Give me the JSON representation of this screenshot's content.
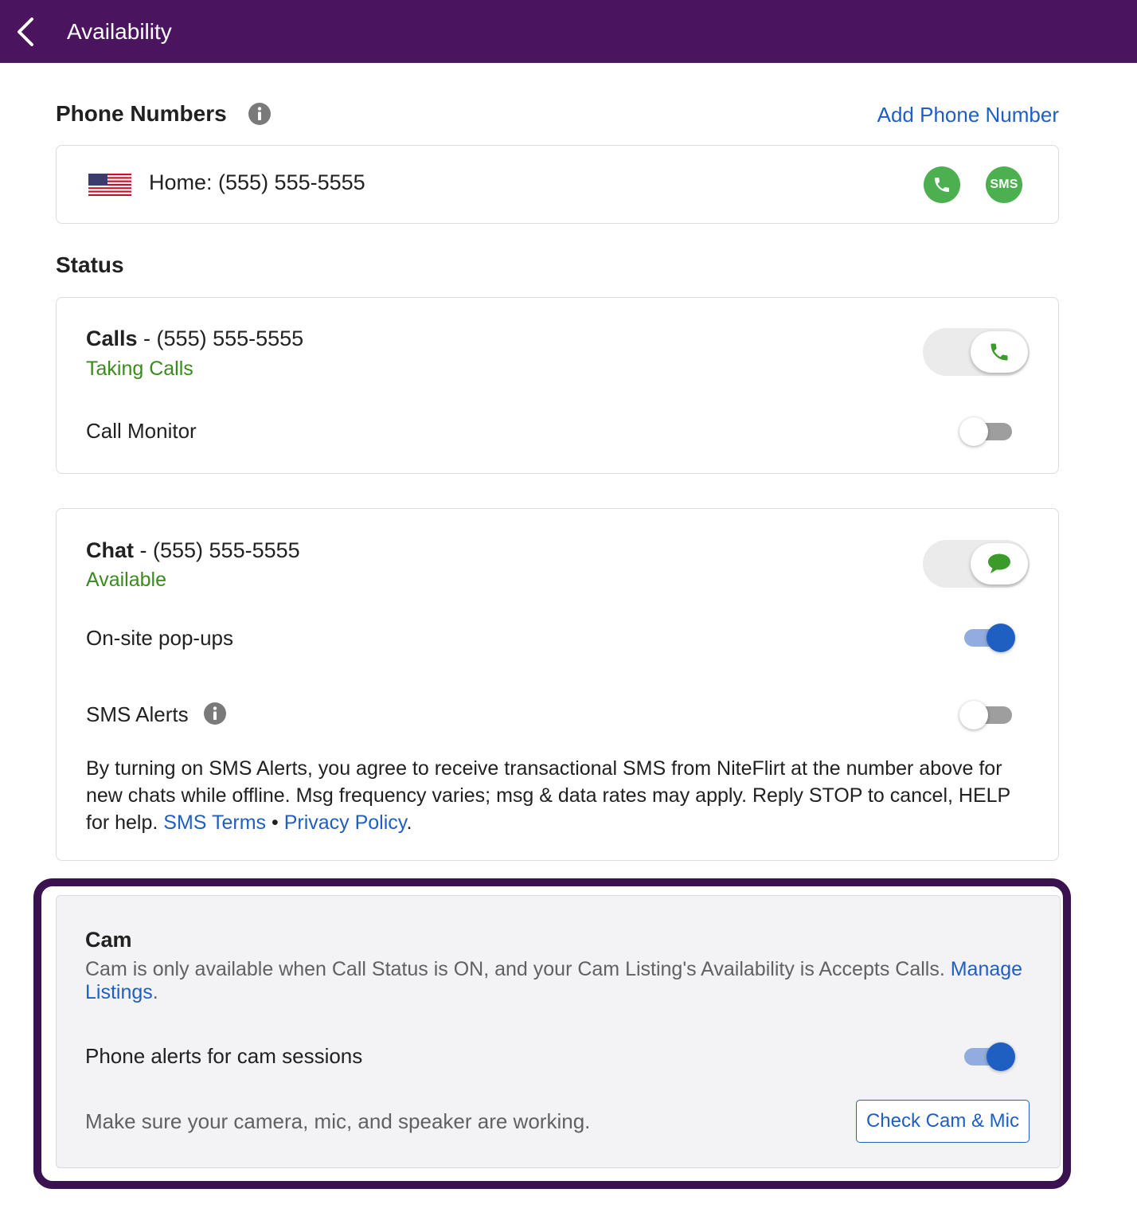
{
  "header": {
    "title": "Availability",
    "background_color": "#4a155e"
  },
  "phone_numbers": {
    "title": "Phone Numbers",
    "add_link": "Add Phone Number",
    "entries": [
      {
        "label": "Home: (555) 555-5555",
        "flag_icon": "us-flag-icon",
        "call_icon": "phone-icon",
        "sms_label": "SMS"
      }
    ]
  },
  "status": {
    "title": "Status",
    "calls": {
      "label": "Calls",
      "separator": " - ",
      "number": "(555) 555-5555",
      "state": "Taking Calls",
      "on": true,
      "monitor_label": "Call Monitor",
      "monitor_on": false
    },
    "chat": {
      "label": "Chat",
      "separator": " - ",
      "number": "(555) 555-5555",
      "state": "Available",
      "on": true,
      "popups_label": "On-site pop-ups",
      "popups_on": true,
      "sms_alerts_label": "SMS Alerts",
      "sms_alerts_on": false,
      "disclaimer": "By turning on SMS Alerts, you agree to receive transactional SMS from NiteFlirt at the number above for new chats while offline. Msg frequency varies; msg & data rates may apply. Reply STOP to cancel, HELP for help.",
      "sms_terms_link": "SMS Terms",
      "bullet": " • ",
      "privacy_link": "Privacy Policy",
      "end_period": "."
    }
  },
  "cam": {
    "title": "Cam",
    "description": "Cam is only available when Call Status is ON, and your Cam Listing's Availability is Accepts Calls.",
    "manage_link": "Manage Listings",
    "end_period": ".",
    "phone_alerts_label": "Phone alerts for cam sessions",
    "phone_alerts_on": true,
    "check_note": "Make sure your camera, mic, and speaker are working.",
    "check_button": "Check Cam & Mic"
  },
  "colors": {
    "accent_blue": "#1f5fc2",
    "status_green": "#3a8a1e",
    "button_green": "#4caf50",
    "highlight_border": "#3a1250"
  }
}
